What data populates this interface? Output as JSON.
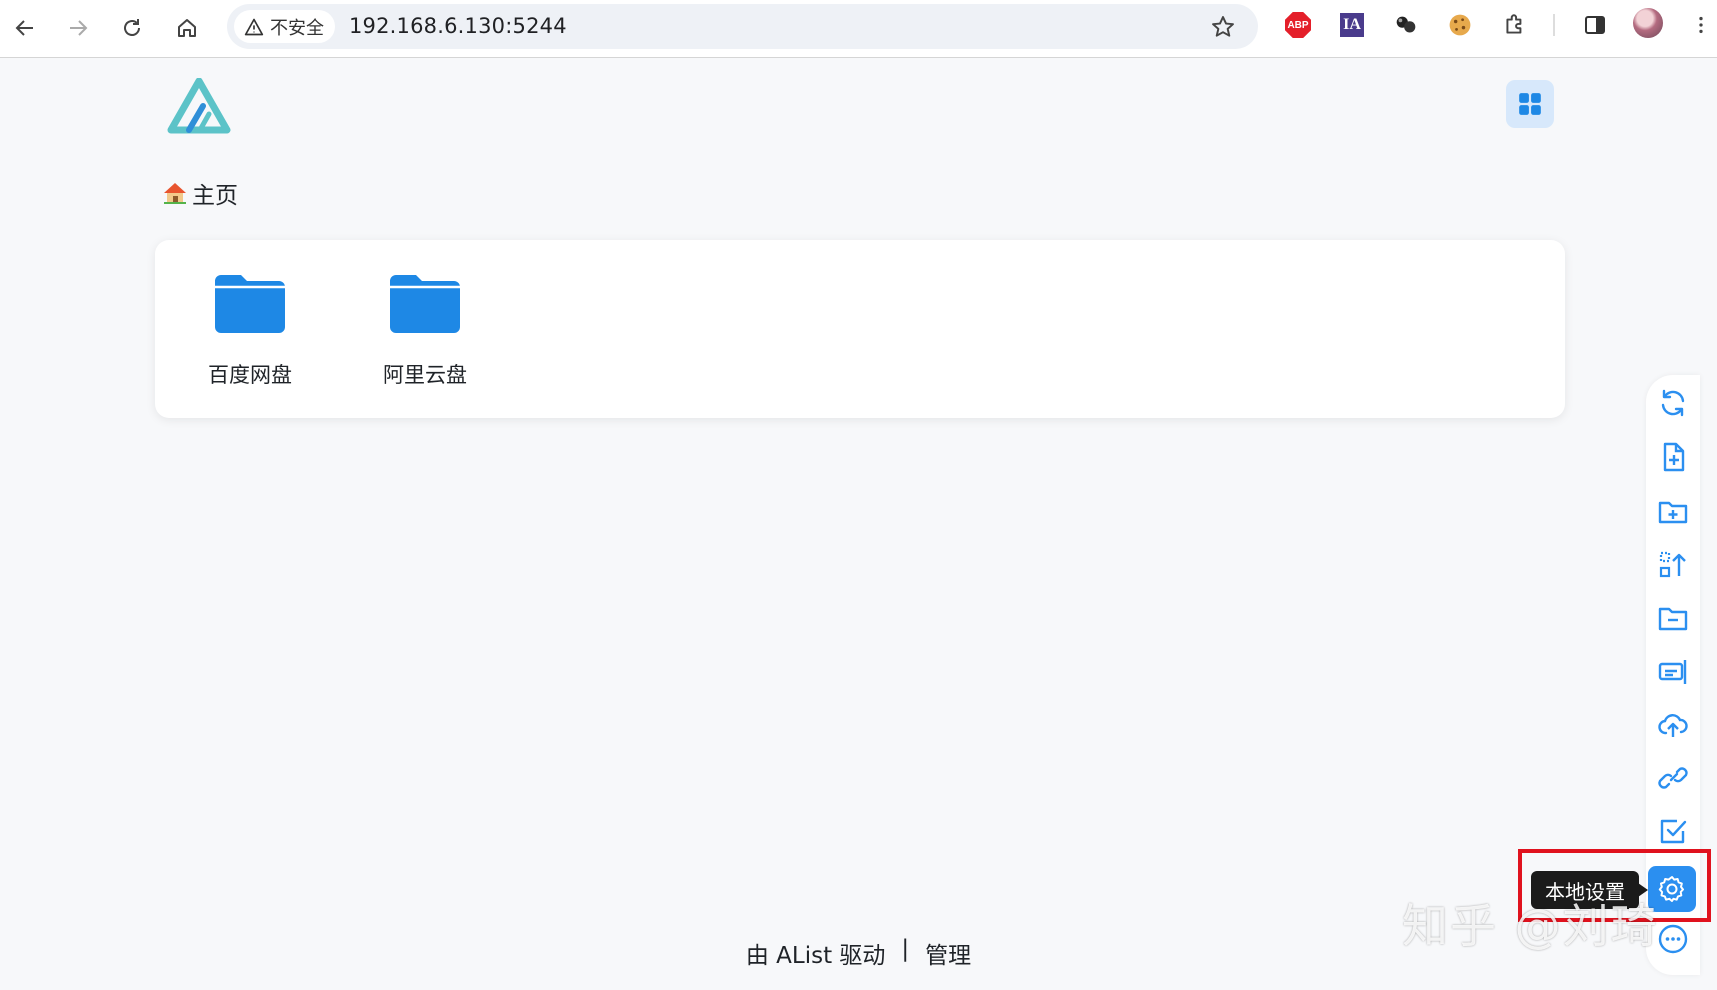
{
  "browser": {
    "security_label": "不安全",
    "url": "192.168.6.130:5244",
    "extensions": [
      "adblock-plus",
      "ia-extension",
      "extension-balls",
      "cookie-extension",
      "extensions-puzzle"
    ],
    "abp_text": "ABP",
    "ia_text": "IA"
  },
  "header": {
    "logo": "alist-logo",
    "layout_toggle": "grid-view-icon"
  },
  "breadcrumb": {
    "home_icon": "house-emoji",
    "label": "主页"
  },
  "files": [
    {
      "name": "百度网盘",
      "type": "folder"
    },
    {
      "name": "阿里云盘",
      "type": "folder"
    }
  ],
  "sidebar": {
    "tooltip": "本地设置",
    "items": [
      "refresh",
      "new-file",
      "new-folder",
      "upload-grid",
      "folder-minus",
      "offline-download",
      "cloud-upload",
      "link",
      "checkbox",
      "settings",
      "more"
    ]
  },
  "footer": {
    "powered": "由 AList 驱动",
    "separator": "|",
    "manage": "管理"
  },
  "watermark": "知乎 @刘琦",
  "colors": {
    "accent": "#2b8ff0",
    "folder": "#1e88e5",
    "highlight": "#e0121e"
  }
}
